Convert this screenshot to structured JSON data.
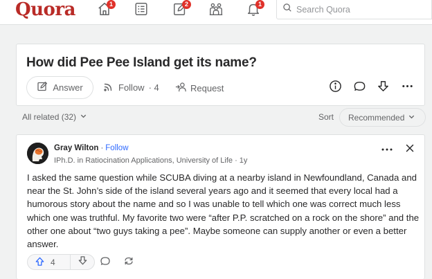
{
  "brand": {
    "logo_text": "Quora",
    "color": "#b92b27"
  },
  "nav": {
    "items": [
      {
        "icon": "home-icon",
        "badge": "1"
      },
      {
        "icon": "following-icon",
        "badge": ""
      },
      {
        "icon": "answer-icon",
        "badge": "2"
      },
      {
        "icon": "spaces-icon",
        "badge": ""
      },
      {
        "icon": "notifications-icon",
        "badge": "1"
      }
    ],
    "search_placeholder": "Search Quora"
  },
  "question": {
    "title": "How did Pee Pee Island get its name?",
    "answer_label": "Answer",
    "follow_label": "Follow",
    "follow_count": "· 4",
    "request_label": "Request"
  },
  "filters": {
    "all_related": "All related (32)",
    "sort_label": "Sort",
    "sort_value": "Recommended"
  },
  "answer": {
    "author": "Gray Wilton",
    "separator": "·",
    "follow": "Follow",
    "credential": "IPh.D. in Ratiocination Applications, University of Life · 1y",
    "body": "I asked the same question while SCUBA diving at a nearby island in Newfoundland, Canada and near the St. John’s side of the island several years ago and it seemed that every local had a humorous story about the name and so I was unable to tell which one was correct much less which one was truthful. My favorite two were “after P.P. scratched on a rock on the shore” and the other one about “two guys taking a pee”. Maybe someone can supply another or even a better answer.",
    "upvotes": "4"
  },
  "colors": {
    "accent": "#2e69ff",
    "badge": "#e0312a",
    "muted": "#636466"
  }
}
